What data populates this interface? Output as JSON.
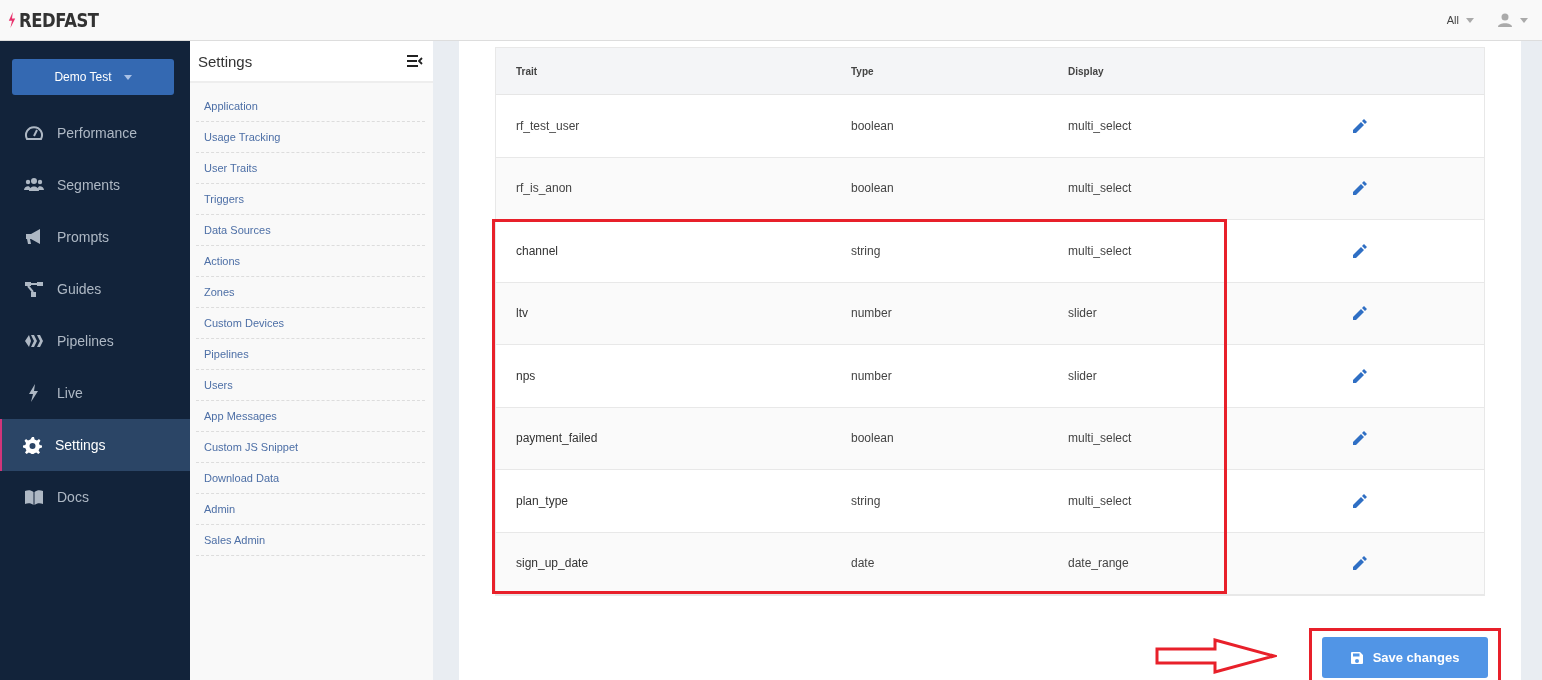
{
  "brand": {
    "name": "REDFAST"
  },
  "topbar": {
    "filter": "All"
  },
  "workspace": {
    "label": "Demo Test"
  },
  "nav": [
    {
      "label": "Performance",
      "kind": "gauge",
      "selected": false
    },
    {
      "label": "Segments",
      "kind": "users",
      "selected": false
    },
    {
      "label": "Prompts",
      "kind": "megaphone",
      "selected": false
    },
    {
      "label": "Guides",
      "kind": "flow",
      "selected": false
    },
    {
      "label": "Pipelines",
      "kind": "chevrons",
      "selected": false
    },
    {
      "label": "Live",
      "kind": "bolt",
      "selected": false
    },
    {
      "label": "Settings",
      "kind": "gear",
      "selected": true
    },
    {
      "label": "Docs",
      "kind": "book",
      "selected": false
    }
  ],
  "settings_menu": {
    "title": "Settings",
    "items": [
      "Application",
      "Usage Tracking",
      "User Traits",
      "Triggers",
      "Data Sources",
      "Actions",
      "Zones",
      "Custom Devices",
      "Pipelines",
      "Users",
      "App Messages",
      "Custom JS Snippet",
      "Download Data",
      "Admin",
      "Sales Admin"
    ]
  },
  "table": {
    "columns": [
      "Trait",
      "Type",
      "Display"
    ],
    "rows": [
      {
        "trait": "rf_test_user",
        "type": "boolean",
        "display": "multi_select",
        "highlighted": false
      },
      {
        "trait": "rf_is_anon",
        "type": "boolean",
        "display": "multi_select",
        "highlighted": false
      },
      {
        "trait": "channel",
        "type": "string",
        "display": "multi_select",
        "highlighted": true
      },
      {
        "trait": "ltv",
        "type": "number",
        "display": "slider",
        "highlighted": true
      },
      {
        "trait": "nps",
        "type": "number",
        "display": "slider",
        "highlighted": true
      },
      {
        "trait": "payment_failed",
        "type": "boolean",
        "display": "multi_select",
        "highlighted": true
      },
      {
        "trait": "plan_type",
        "type": "string",
        "display": "multi_select",
        "highlighted": true
      },
      {
        "trait": "sign_up_date",
        "type": "date",
        "display": "date_range",
        "highlighted": true
      }
    ]
  },
  "save_button": {
    "label": "Save changes",
    "highlighted": true,
    "pointer_arrow": true
  }
}
